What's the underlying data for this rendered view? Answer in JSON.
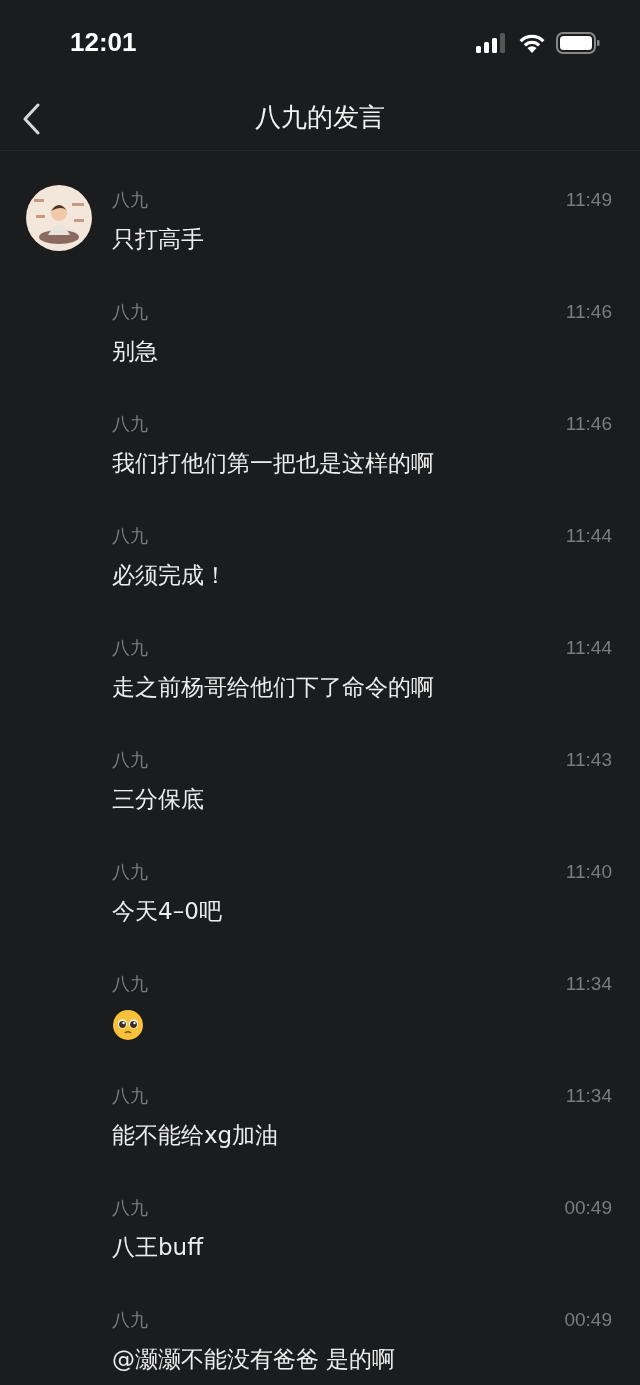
{
  "status_bar": {
    "time": "12:01"
  },
  "header": {
    "title": "八九的发言"
  },
  "messages": [
    {
      "kind": "text",
      "name": "八九",
      "time": "11:49",
      "text": "只打高手",
      "avatar": true
    },
    {
      "kind": "text",
      "name": "八九",
      "time": "11:46",
      "text": "别急",
      "avatar": false
    },
    {
      "kind": "text",
      "name": "八九",
      "time": "11:46",
      "text": "我们打他们第一把也是这样的啊",
      "avatar": false
    },
    {
      "kind": "text",
      "name": "八九",
      "time": "11:44",
      "text": "必须完成！",
      "avatar": false
    },
    {
      "kind": "text",
      "name": "八九",
      "time": "11:44",
      "text": "走之前杨哥给他们下了命令的啊",
      "avatar": false
    },
    {
      "kind": "text",
      "name": "八九",
      "time": "11:43",
      "text": "三分保底",
      "avatar": false
    },
    {
      "kind": "text",
      "name": "八九",
      "time": "11:40",
      "text": "今天4–0吧",
      "avatar": false
    },
    {
      "kind": "emoji",
      "name": "八九",
      "time": "11:34",
      "avatar": false
    },
    {
      "kind": "text",
      "name": "八九",
      "time": "11:34",
      "text": "能不能给xg加油",
      "avatar": false
    },
    {
      "kind": "text",
      "name": "八九",
      "time": "00:49",
      "text": "八王buff",
      "avatar": false
    },
    {
      "kind": "text",
      "name": "八九",
      "time": "00:49",
      "text": "@灏灏不能没有爸爸 是的啊",
      "avatar": false
    }
  ]
}
